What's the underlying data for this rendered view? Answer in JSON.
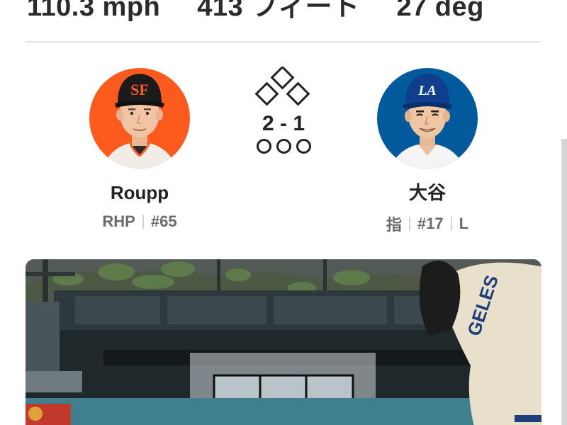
{
  "stats": {
    "exit_velocity": "110.3 mph",
    "distance": "413 フィート",
    "launch_angle": "27 deg"
  },
  "pitcher": {
    "name": "Roupp",
    "position": "RHP",
    "number": "#65",
    "avatar_bg": "#fd5a1e",
    "avatar": "giants-player-photo"
  },
  "batter": {
    "name": "大谷",
    "position": "指",
    "number": "#17",
    "bats": "L",
    "avatar_bg": "#005a9c",
    "avatar": "dodgers-player-photo"
  },
  "game_state": {
    "count": "2 - 1",
    "bases": [
      "empty",
      "empty",
      "empty"
    ],
    "outs": 0
  },
  "video": {
    "thumbnail": "highlight-video-thumbnail"
  }
}
